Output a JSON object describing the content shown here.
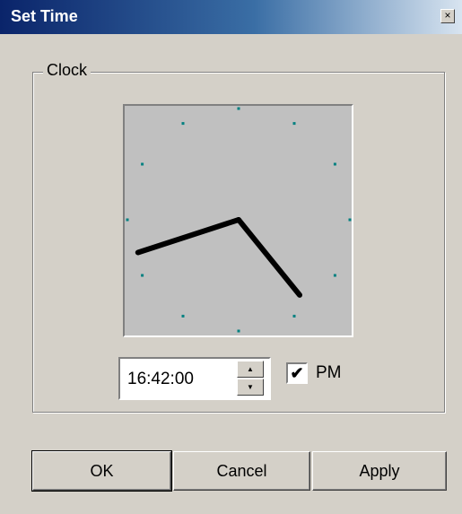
{
  "window": {
    "title": "Set Time",
    "close_label": "×",
    "close_icon": "close-icon"
  },
  "clock_group": {
    "label": "Clock"
  },
  "clock": {
    "hour": 16,
    "minute": 42,
    "second": 0
  },
  "time_field": {
    "value": "16:42:00",
    "spin_up_icon": "arrow-up-icon",
    "spin_down_icon": "arrow-down-icon",
    "spin_up_label": "▲",
    "spin_down_label": "▼"
  },
  "pm": {
    "label": "PM",
    "checked": true,
    "check_mark": "✔"
  },
  "buttons": {
    "ok": "OK",
    "cancel": "Cancel",
    "apply": "Apply"
  },
  "colors": {
    "face": "#c0c0c0",
    "tick": "#008080",
    "hand": "#000000"
  }
}
